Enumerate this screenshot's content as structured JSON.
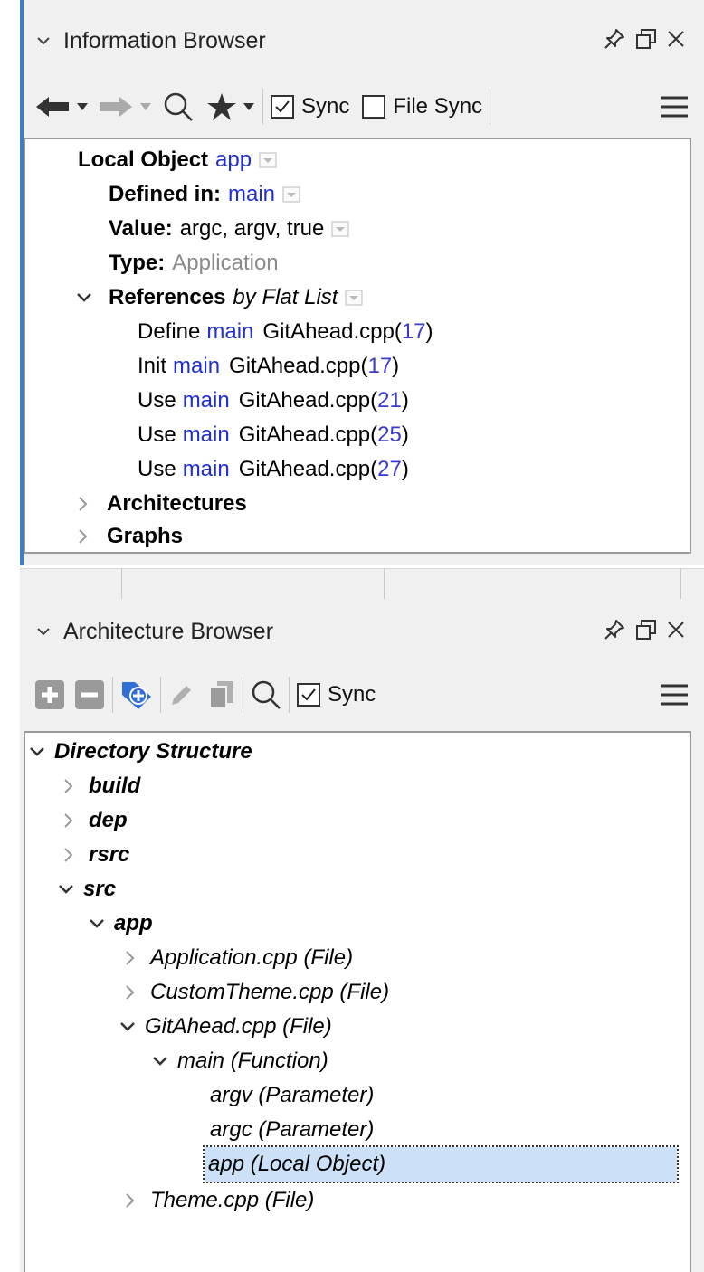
{
  "info_browser": {
    "title": "Information Browser",
    "toolbar": {
      "sync_label": "Sync",
      "sync_checked": true,
      "file_sync_label": "File Sync",
      "file_sync_checked": false
    },
    "object": {
      "kind": "Local Object",
      "name": "app"
    },
    "defined_in": {
      "label": "Defined in:",
      "value": "main"
    },
    "value": {
      "label": "Value:",
      "value": "argc, argv, true"
    },
    "type": {
      "label": "Type:",
      "value": "Application"
    },
    "references": {
      "label": "References",
      "mode": "by Flat List",
      "items": [
        {
          "kind": "Define",
          "scope": "main",
          "file": "GitAhead.cpp(",
          "line": "17",
          "close": ")"
        },
        {
          "kind": "Init",
          "scope": "main",
          "file": "GitAhead.cpp(",
          "line": "17",
          "close": ")"
        },
        {
          "kind": "Use",
          "scope": "main",
          "file": "GitAhead.cpp(",
          "line": "21",
          "close": ")"
        },
        {
          "kind": "Use",
          "scope": "main",
          "file": "GitAhead.cpp(",
          "line": "25",
          "close": ")"
        },
        {
          "kind": "Use",
          "scope": "main",
          "file": "GitAhead.cpp(",
          "line": "27",
          "close": ")"
        }
      ]
    },
    "architectures_label": "Architectures",
    "graphs_label": "Graphs"
  },
  "arch_browser": {
    "title": "Architecture Browser",
    "toolbar": {
      "sync_label": "Sync",
      "sync_checked": true
    },
    "tree": {
      "root": "Directory Structure",
      "build": "build",
      "dep": "dep",
      "rsrc": "rsrc",
      "src": "src",
      "app": "app",
      "application_cpp": "Application.cpp (File)",
      "customtheme_cpp": "CustomTheme.cpp (File)",
      "gitahead_cpp": "GitAhead.cpp (File)",
      "main_fn": "main (Function)",
      "argv": "argv (Parameter)",
      "argc": "argc (Parameter)",
      "app_local": "app (Local Object)",
      "theme_cpp": "Theme.cpp (File)"
    }
  },
  "colors": {
    "link": "#1f2fd0",
    "selection": "#cce0f7",
    "accent": "#3b7fc4",
    "panel_bg": "#f0f0f0"
  }
}
